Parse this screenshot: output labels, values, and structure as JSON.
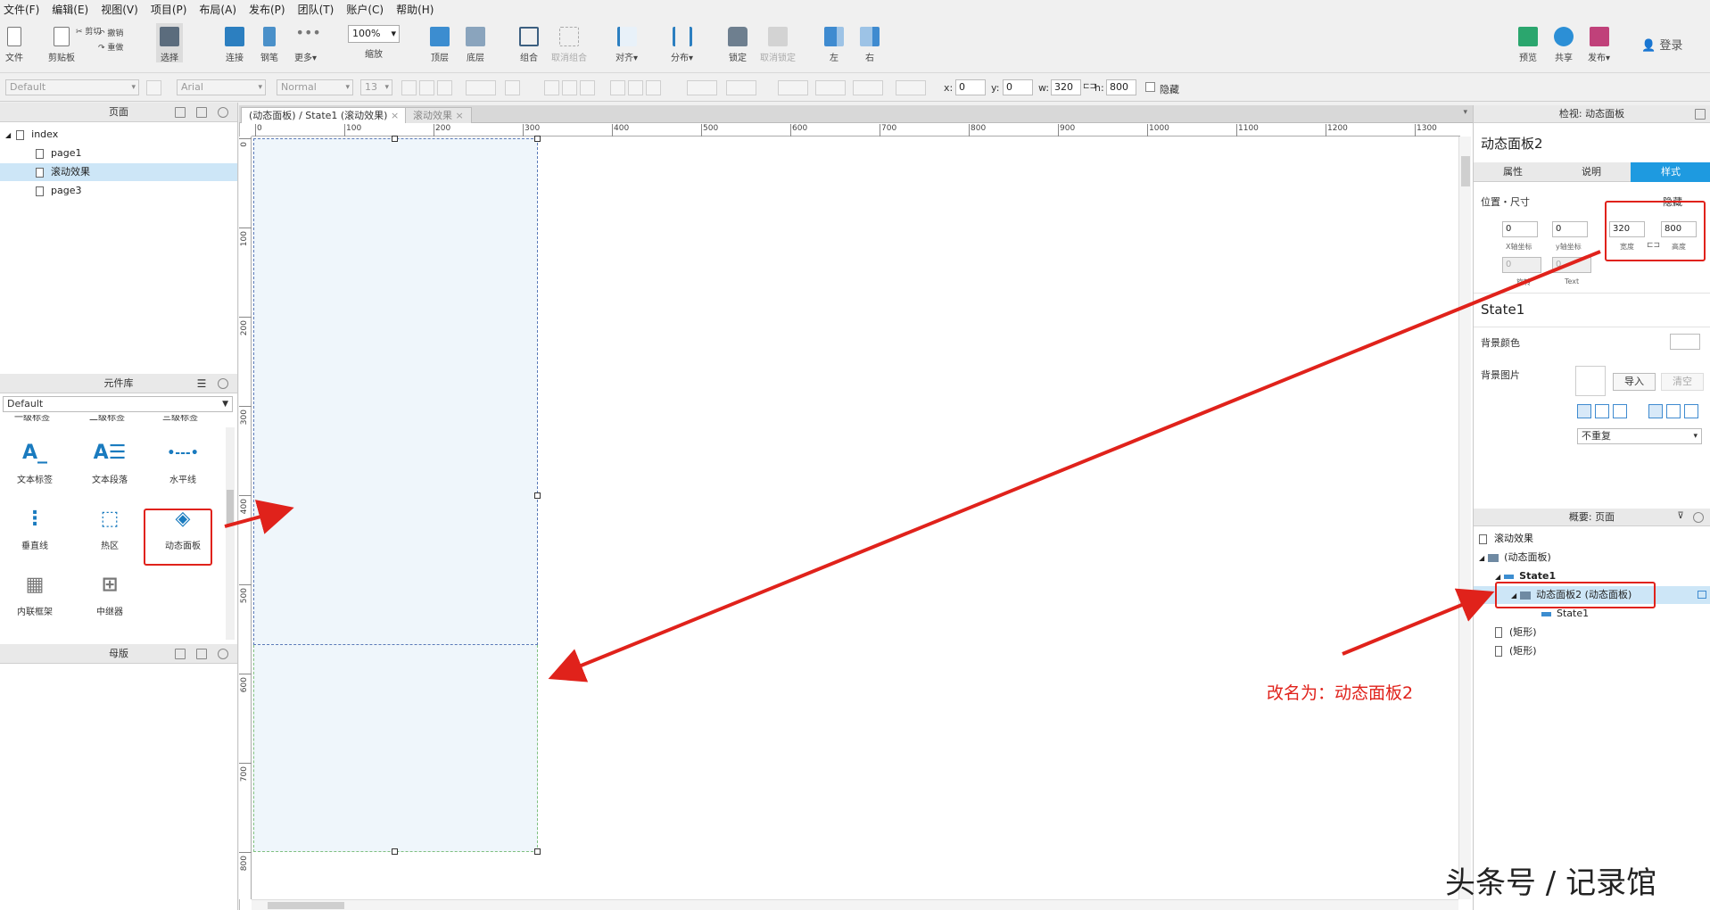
{
  "menu": [
    "文件(F)",
    "编辑(E)",
    "视图(V)",
    "项目(P)",
    "布局(A)",
    "发布(P)",
    "团队(T)",
    "账户(C)",
    "帮助(H)"
  ],
  "toolbar": {
    "file": "文件",
    "clipboard": "剪贴板",
    "cut": "剪切",
    "copy": "复制",
    "undo": "撤销",
    "redo": "重做",
    "select": "选择",
    "connect": "连接",
    "pen": "钢笔",
    "more": "更多▾",
    "zoom_value": "100%",
    "zoom_label": "缩放",
    "top": "顶层",
    "bottom": "底层",
    "group": "组合",
    "ungroup": "取消组合",
    "align": "对齐▾",
    "distribute": "分布▾",
    "lock": "锁定",
    "unlock": "取消锁定",
    "left": "左",
    "right": "右",
    "preview": "预览",
    "share": "共享",
    "publish": "发布▾",
    "login": "登录"
  },
  "format": {
    "style": "Default",
    "font": "Arial",
    "weight": "Normal",
    "size": "13",
    "x_label": "x:",
    "x_value": "0",
    "y_label": "y:",
    "y_value": "0",
    "w_label": "w:",
    "w_value": "320",
    "h_label": "h:",
    "h_value": "800",
    "hide_label": "隐藏"
  },
  "pages_panel": {
    "title": "页面",
    "items": [
      "index",
      "page1",
      "滚动效果",
      "page3"
    ]
  },
  "library_panel": {
    "title": "元件库",
    "library": "Default",
    "partial_labels": [
      "一级标签",
      "二级标签",
      "三级标签"
    ],
    "widgets": [
      "文本标签",
      "文本段落",
      "水平线",
      "垂直线",
      "热区",
      "动态面板",
      "内联框架",
      "中继器"
    ]
  },
  "masters_panel": {
    "title": "母版"
  },
  "tabs": [
    "(动态面板) / State1 (滚动效果)",
    "滚动效果"
  ],
  "ruler": {
    "h": [
      "0",
      "100",
      "200",
      "300",
      "400",
      "500",
      "600",
      "700",
      "800",
      "900",
      "1000",
      "1100",
      "1200",
      "1300"
    ],
    "v": [
      "0",
      "100",
      "200",
      "300",
      "400",
      "500",
      "600",
      "700",
      "800"
    ]
  },
  "inspector": {
    "header": "检视: 动态面板",
    "name": "动态面板2",
    "tabs": [
      "属性",
      "说明",
      "样式"
    ],
    "position_label": "位置・尺寸",
    "hide": "隐藏",
    "x": "0",
    "y": "0",
    "w": "320",
    "h": "800",
    "x_label": "X轴坐标",
    "y_label": "y轴坐标",
    "w_label": "宽度",
    "h_label": "高度",
    "rotate_value": "0",
    "text_value": "0",
    "rotate_label": "旋转",
    "text_label": "Text",
    "state_name": "State1",
    "bg_color_label": "背景颜色",
    "bg_image_label": "背景图片",
    "import": "导入",
    "clear": "清空",
    "repeat": "不重复"
  },
  "outline": {
    "header": "概要: 页面",
    "items": [
      "滚动效果",
      "(动态面板)",
      "State1",
      "动态面板2 (动态面板)",
      "State1",
      "(矩形)",
      "(矩形)"
    ]
  },
  "annotation": "改名为：动态面板2",
  "watermark": "头条号 / 记录馆"
}
